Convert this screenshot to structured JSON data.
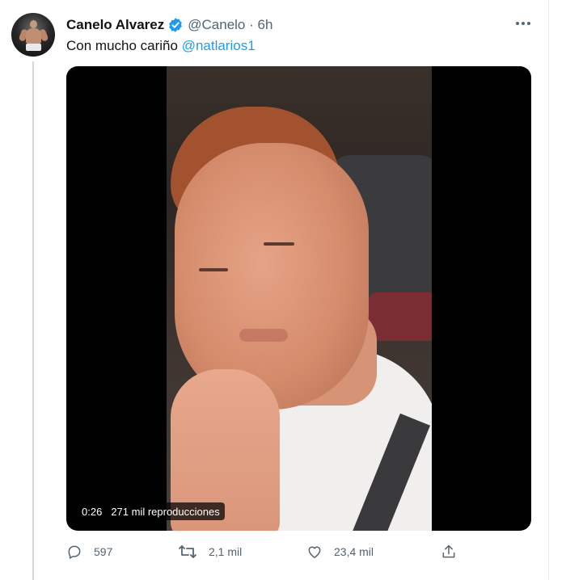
{
  "tweet": {
    "author_name": "Canelo Alvarez",
    "handle_time": "@Canelo · 6h",
    "text": "Con mucho cariño ",
    "mention": "@natlarios1"
  },
  "video": {
    "duration": "0:26",
    "views": "271 mil reproducciones"
  },
  "actions": {
    "replies": "597",
    "retweets": "2,1 mil",
    "likes": "23,4 mil"
  },
  "icons": {
    "verified": "verified-badge-icon",
    "more": "more-icon",
    "reply": "reply-icon",
    "retweet": "retweet-icon",
    "like": "heart-icon",
    "share": "share-icon"
  },
  "colors": {
    "accent": "#1d9bf0",
    "text": "#0f1419",
    "secondary": "#536471",
    "thread_line": "#cfd9de"
  }
}
